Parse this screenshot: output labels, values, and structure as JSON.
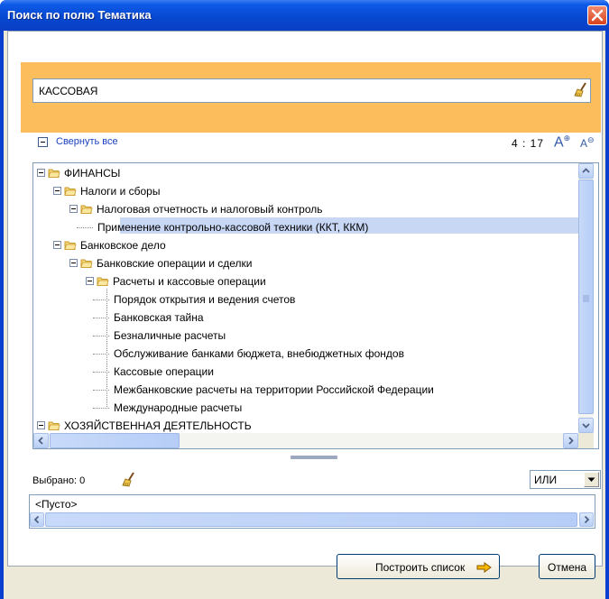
{
  "window": {
    "title": "Поиск по полю Тематика"
  },
  "search": {
    "value": "КАССОВАЯ"
  },
  "toolbar": {
    "collapse_all": "Свернуть все",
    "count": "4 : 17",
    "font_increase": "A",
    "font_decrease": "A"
  },
  "tree": {
    "nodes": [
      {
        "label": "ФИНАНСЫ",
        "level": 0
      },
      {
        "label": "Налоги и сборы",
        "level": 1
      },
      {
        "label": "Налоговая отчетность и налоговый контроль",
        "level": 2
      },
      {
        "label": "Применение контрольно-кассовой техники (ККТ, ККМ)",
        "level": 3,
        "selected": true
      },
      {
        "label": "Банковское дело",
        "level": 1
      },
      {
        "label": "Банковские операции и сделки",
        "level": 2
      },
      {
        "label": "Расчеты и кассовые операции",
        "level": 3
      },
      {
        "label": "Порядок открытия и ведения счетов",
        "level": 4
      },
      {
        "label": "Банковская тайна",
        "level": 4
      },
      {
        "label": "Безналичные расчеты",
        "level": 4
      },
      {
        "label": "Обслуживание банками бюджета, внебюджетных фондов",
        "level": 4
      },
      {
        "label": "Кассовые операции",
        "level": 4
      },
      {
        "label": "Межбанковские расчеты на территории Российской Федерации",
        "level": 4
      },
      {
        "label": "Международные расчеты",
        "level": 4
      },
      {
        "label": "ХОЗЯЙСТВЕННАЯ ДЕЯТЕЛЬНОСТЬ",
        "level": 0
      }
    ]
  },
  "selection": {
    "label": "Выбрано: 0",
    "operator": "ИЛИ",
    "empty": "<Пусто>"
  },
  "buttons": {
    "build_list": "Построить список",
    "cancel": "Отмена"
  },
  "colors": {
    "titlebar": "#0a4fd6",
    "accent_panel": "#fcbe5c",
    "selection_bg": "#c7d7f4",
    "link": "#1a3fc0"
  }
}
